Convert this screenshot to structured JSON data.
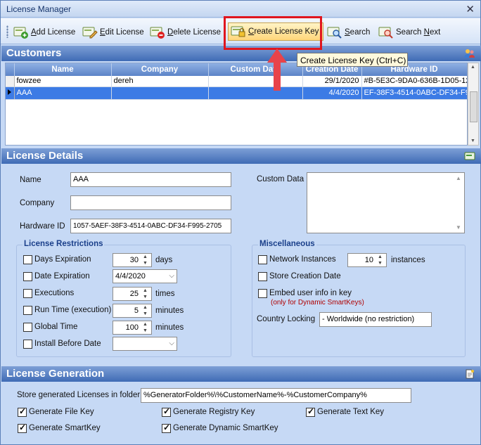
{
  "window": {
    "title": "License Manager",
    "close_glyph": "✕"
  },
  "toolbar": {
    "add_prefix": "",
    "add_u": "A",
    "add_rest": "dd License",
    "edit_u": "E",
    "edit_rest": "dit License",
    "delete_u": "D",
    "delete_rest": "elete License",
    "create_u": "C",
    "create_rest": "reate License Key",
    "search_u": "S",
    "search_rest": "earch",
    "next_pre": "Search ",
    "next_u": "N",
    "next_rest": "ext"
  },
  "tooltip": "Create License Key (Ctrl+C)",
  "customers": {
    "header": "Customers",
    "columns": [
      "Name",
      "Company",
      "Custom Data",
      "Creation Date",
      "Hardware ID"
    ],
    "rows": [
      {
        "name": "fowzee",
        "company": "dereh",
        "custom": "",
        "date": "29/1/2020",
        "hwid": "#B-5E3C-9DA0-636B-1D05-12",
        "selected": false
      },
      {
        "name": "AAA",
        "company": "",
        "custom": "",
        "date": "4/4/2020",
        "hwid": "EF-38F3-4514-0ABC-DF34-F9",
        "selected": true
      }
    ]
  },
  "details": {
    "header": "License Details",
    "name_label": "Name",
    "name_value": "AAA",
    "company_label": "Company",
    "company_value": "",
    "hwid_label": "Hardware ID",
    "hwid_value": "1057-5AEF-38F3-4514-0ABC-DF34-F995-2705",
    "custom_label": "Custom Data"
  },
  "restrictions": {
    "title": "License Restrictions",
    "days_label": "Days Expiration",
    "days_value": "30",
    "days_unit": "days",
    "date_label": "Date Expiration",
    "date_value": "4/4/2020",
    "exec_label": "Executions",
    "exec_value": "25",
    "exec_unit": "times",
    "runtime_label": "Run Time (execution)",
    "runtime_value": "5",
    "runtime_unit": "minutes",
    "global_label": "Global Time",
    "global_value": "100",
    "global_unit": "minutes",
    "install_label": "Install Before Date",
    "install_value": ""
  },
  "misc": {
    "title": "Miscellaneous",
    "network_label": "Network Instances",
    "network_value": "10",
    "network_unit": "instances",
    "store_label": "Store Creation Date",
    "embed_label": "Embed user info in key",
    "embed_note": "(only for Dynamic SmartKeys)",
    "country_label": "Country Locking",
    "country_value": "- Worldwide (no restriction)"
  },
  "generation": {
    "header": "License Generation",
    "folder_label": "Store generated Licenses in folder:",
    "folder_value": "%GeneratorFolder%\\%CustomerName%-%CustomerCompany%",
    "file_key": "Generate File Key",
    "registry_key": "Generate Registry Key",
    "text_key": "Generate Text Key",
    "smartkey": "Generate SmartKey",
    "dynamic_smartkey": "Generate Dynamic SmartKey"
  },
  "colors": {
    "accent_red": "#e0161e",
    "selection": "#3c7be5",
    "header_blue": "#3f6bb5"
  }
}
